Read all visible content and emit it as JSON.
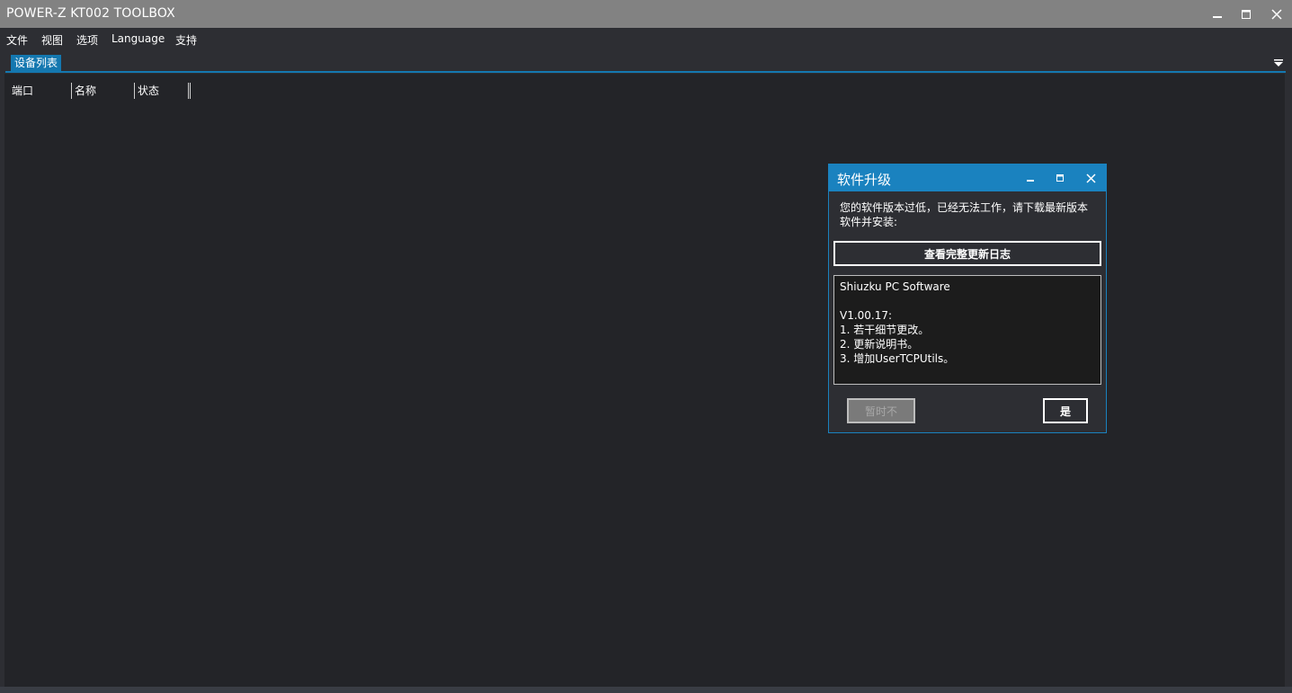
{
  "window": {
    "title": "POWER-Z KT002 TOOLBOX",
    "controls": [
      "minimize-icon",
      "maximize-icon",
      "close-icon"
    ]
  },
  "menu": {
    "items": [
      "文件",
      "视图",
      "选项",
      "Language",
      "支持"
    ]
  },
  "tabs": {
    "active_label": "设备列表",
    "menu_icon": "dropdown-menu-icon"
  },
  "device_table": {
    "columns": [
      "端口",
      "名称",
      "状态"
    ]
  },
  "dialog": {
    "title": "软件升级",
    "message": "您的软件版本过低，已经无法工作，请下载最新版本软件并安装:",
    "changelog_button": "查看完整更新日志",
    "notes": [
      "Shiuzku PC Software",
      "",
      "V1.00.17:",
      "1. 若干细节更改。",
      "2. 更新说明书。",
      "3. 增加UserTCPUtils。"
    ],
    "later_button": "暂时不",
    "yes_button": "是"
  },
  "colors": {
    "accent": "#1a82bf",
    "titlebar": "#828282",
    "background": "#232428"
  }
}
